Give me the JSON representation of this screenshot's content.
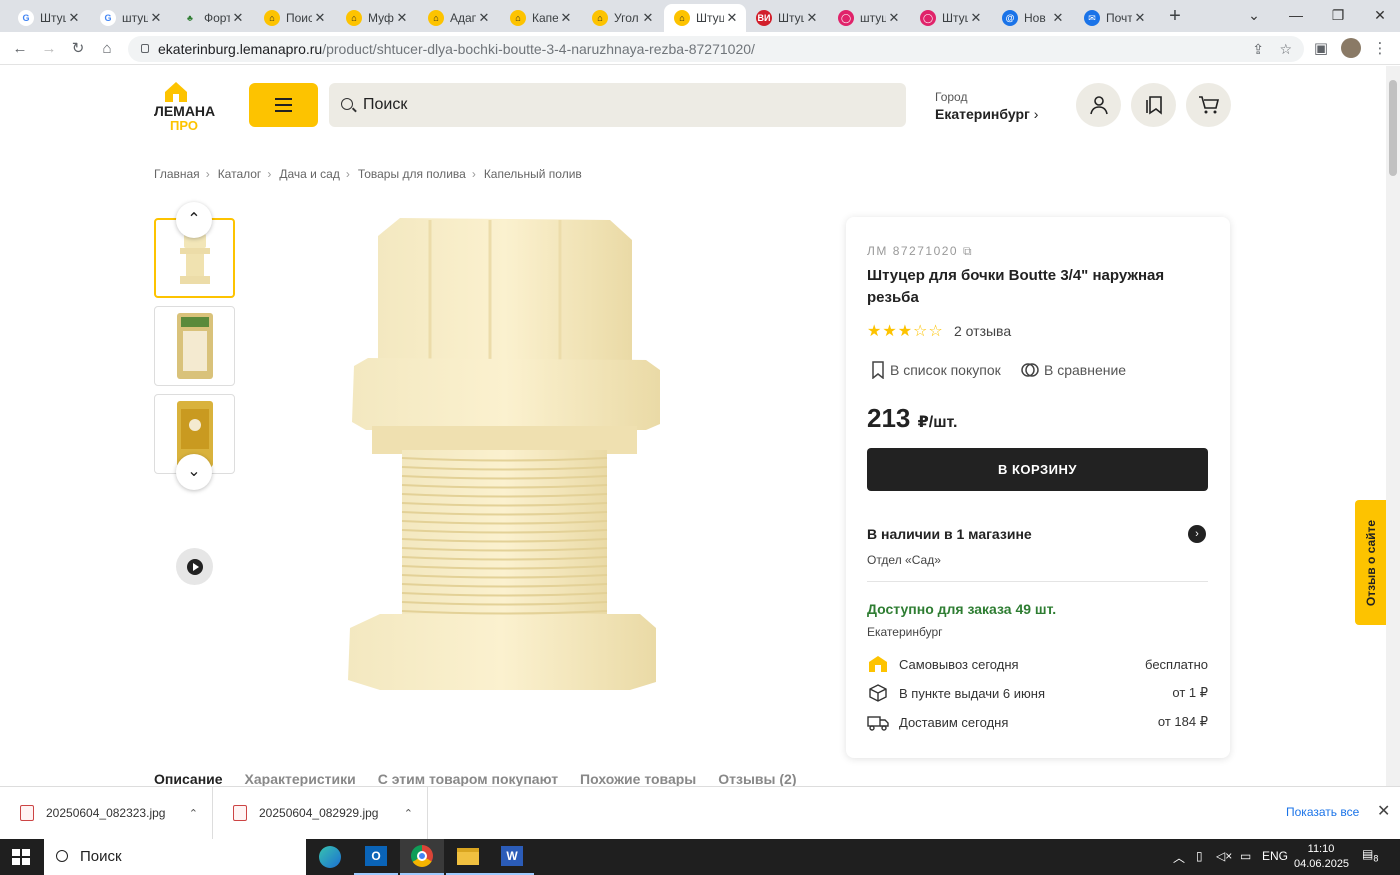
{
  "browser": {
    "tabs": [
      {
        "label": "Штуц",
        "fav": "google"
      },
      {
        "label": "штуц",
        "fav": "google"
      },
      {
        "label": "Форт",
        "fav": "leaf"
      },
      {
        "label": "Поис",
        "fav": "lemana"
      },
      {
        "label": "Муф",
        "fav": "lemana"
      },
      {
        "label": "Адап",
        "fav": "lemana"
      },
      {
        "label": "Капе",
        "fav": "lemana"
      },
      {
        "label": "Угол",
        "fav": "lemana"
      },
      {
        "label": "Штуц",
        "fav": "lemana",
        "active": true
      },
      {
        "label": "Штуц",
        "fav": "vi"
      },
      {
        "label": "штуц",
        "fav": "ozon"
      },
      {
        "label": "Штуц",
        "fav": "ozon"
      },
      {
        "label": "Нов",
        "fav": "mail"
      },
      {
        "label": "Почт",
        "fav": "mailbox"
      }
    ],
    "url_host": "ekaterinburg.lemanapro.ru",
    "url_path": "/product/shtucer-dlya-bochki-boutte-3-4-naruzhnaya-rezba-87271020/"
  },
  "header": {
    "logo_top": "ЛЕМАНА",
    "logo_bottom": "ПРО",
    "search_placeholder": "Поиск",
    "city_label": "Город",
    "city_value": "Екатеринбург"
  },
  "breadcrumbs": [
    "Главная",
    "Каталог",
    "Дача и сад",
    "Товары для полива",
    "Капельный полив"
  ],
  "product": {
    "sku": "ЛМ 87271020",
    "title": "Штуцер для бочки Boutte 3/4\" наружная резьба",
    "rating": 3,
    "rating_max": 5,
    "reviews": "2 отзыва",
    "shopping_list": "В список покупок",
    "compare": "В сравнение",
    "price": "213",
    "price_unit": "₽/шт.",
    "buy_button": "В КОРЗИНУ",
    "availability": "В наличии в 1 магазине",
    "department": "Отдел «Сад»",
    "order_available": "Доступно для заказа 49 шт.",
    "order_city": "Екатеринбург",
    "delivery": [
      {
        "label": "Самовывоз сегодня",
        "value": "бесплатно"
      },
      {
        "label": "В пункте выдачи 6 июня",
        "value": "от 1 ₽"
      },
      {
        "label": "Доставим сегодня",
        "value": "от 184 ₽"
      }
    ]
  },
  "tabs": [
    "Описание",
    "Характеристики",
    "С этим товаром покупают",
    "Похожие товары",
    "Отзывы (2)"
  ],
  "feedback_tab": "Отзыв о сайте",
  "downloads": {
    "items": [
      "20250604_082323.jpg",
      "20250604_082929.jpg"
    ],
    "show_all": "Показать все"
  },
  "taskbar": {
    "search": "Поиск",
    "lang": "ENG",
    "time": "11:10",
    "date": "04.06.2025",
    "notifications": "8"
  },
  "colors": {
    "brand": "#fdc300",
    "dark": "#222222",
    "green": "#2e7d32"
  }
}
